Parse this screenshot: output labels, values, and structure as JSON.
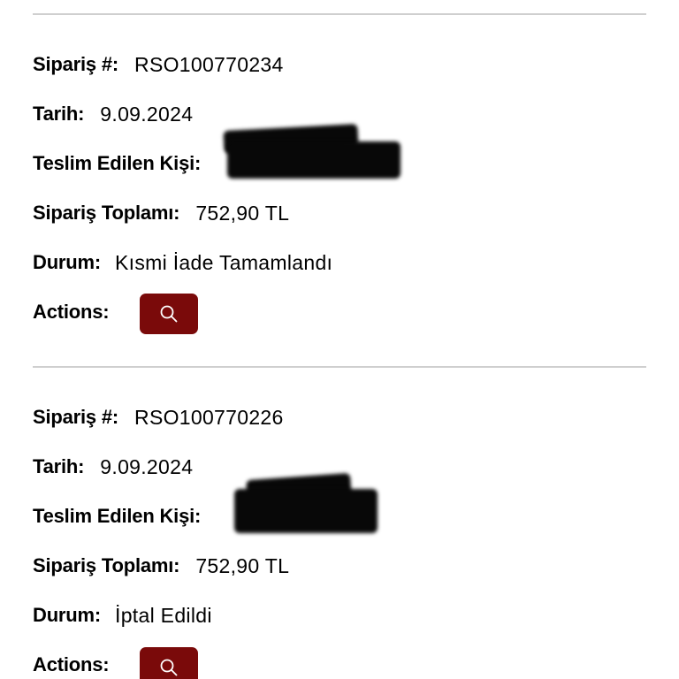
{
  "labels": {
    "order_no": "Sipariş #:",
    "date": "Tarih:",
    "recipient": "Teslim Edilen Kişi:",
    "total": "Sipariş Toplamı:",
    "status": "Durum:",
    "actions": "Actions:"
  },
  "orders": [
    {
      "order_no": "RSO100770234",
      "date": "9.09.2024",
      "total": "752,90 TL",
      "status": "Kısmi İade Tamamlandı",
      "action_icon": "search-icon"
    },
    {
      "order_no": "RSO100770226",
      "date": "9.09.2024",
      "total": "752,90 TL",
      "status": "İptal Edildi",
      "action_icon": "search-icon"
    }
  ],
  "colors": {
    "action_button": "#7a0a0a",
    "divider": "#cfcfcf",
    "redaction": "#080808"
  }
}
